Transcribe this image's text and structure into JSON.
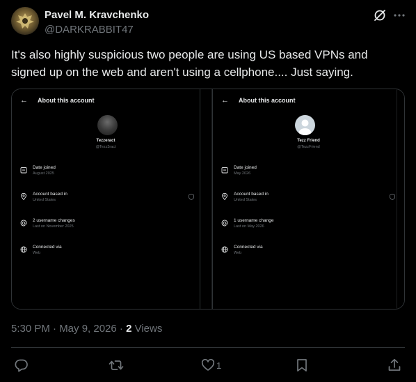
{
  "post": {
    "author": {
      "display_name": "Pavel M. Kravchenko",
      "handle": "@DARKRABBIT47",
      "avatar_icon": "eagle-emblem-avatar"
    },
    "text": "It's also highly suspicious two people are using US based VPNs and signed up on the web and aren't using a cellphone.... Just saying.",
    "timestamp": "5:30 PM · May 9, 2026",
    "views_count": "2",
    "views_label": "Views",
    "actions": {
      "reply_icon": "reply-icon",
      "repost_icon": "repost-icon",
      "like_icon": "heart-icon",
      "like_count": "1",
      "bookmark_icon": "bookmark-icon",
      "share_icon": "share-icon"
    }
  },
  "media": {
    "panels": [
      {
        "title": "About this account",
        "name": "Tezzeract",
        "handle": "@Tezz3ract",
        "rows": [
          {
            "label": "Date joined",
            "value": "August 2025",
            "icon": "calendar-icon"
          },
          {
            "label": "Account based in",
            "value": "United States",
            "icon": "location-icon",
            "badge": "shield-icon"
          },
          {
            "label": "2 username changes",
            "value": "Last on November 2025",
            "icon": "at-icon"
          },
          {
            "label": "Connected via",
            "value": "Web",
            "icon": "globe-icon"
          }
        ]
      },
      {
        "title": "About this account",
        "name": "Tezz Friend",
        "handle": "@TezzFriend",
        "rows": [
          {
            "label": "Date joined",
            "value": "May 2026",
            "icon": "calendar-icon"
          },
          {
            "label": "Account based in",
            "value": "United States",
            "icon": "location-icon",
            "badge": "shield-icon"
          },
          {
            "label": "1 username change",
            "value": "Last on May 2026",
            "icon": "at-icon"
          },
          {
            "label": "Connected via",
            "value": "Web",
            "icon": "globe-icon"
          }
        ]
      }
    ]
  },
  "colors": {
    "background": "#000000",
    "text_primary": "#e7e9ea",
    "text_secondary": "#71767b",
    "border": "#2f3336"
  }
}
